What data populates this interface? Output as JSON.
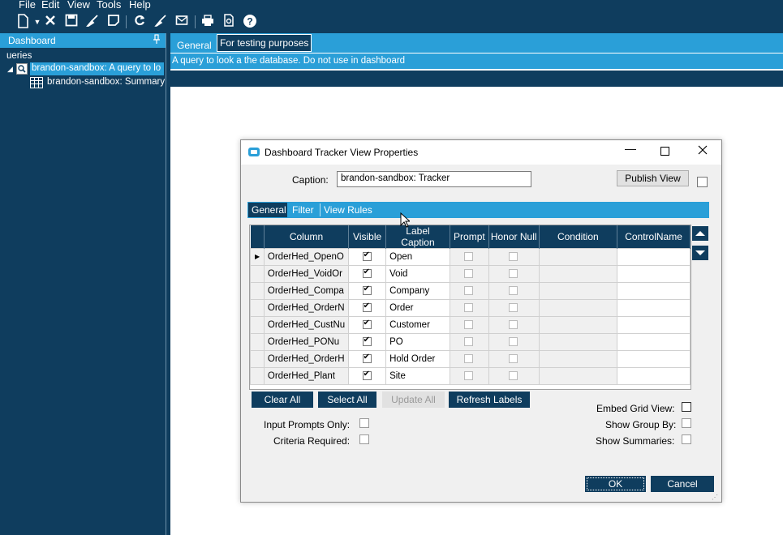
{
  "menu": [
    "File",
    "Edit",
    "View",
    "Tools",
    "Help"
  ],
  "left_panel": {
    "title": "Dashboard",
    "pin": "📌",
    "queries_label": "ueries",
    "items": [
      {
        "label": "brandon-sandbox: A query to lo",
        "selected": true
      },
      {
        "label": "brandon-sandbox: Summary",
        "selected": false
      }
    ]
  },
  "tabs": [
    "General",
    "For testing purposes"
  ],
  "description": "A query to look a the database. Do not use in dashboard",
  "dialog": {
    "title": "Dashboard Tracker View Properties",
    "caption_label": "Caption:",
    "caption_value": "brandon-sandbox: Tracker",
    "publish_button": "Publish View",
    "tabs": [
      "General",
      "Filter",
      "View Rules"
    ],
    "columns": [
      "Column",
      "Visible",
      "Label Caption",
      "Prompt",
      "Honor Null",
      "Condition",
      "ControlName"
    ],
    "rows": [
      {
        "column": "OrderHed_OpenO",
        "label": "Open",
        "visible": true,
        "current": true
      },
      {
        "column": "OrderHed_VoidOr",
        "label": "Void",
        "visible": true
      },
      {
        "column": "OrderHed_Compa",
        "label": "Company",
        "visible": true
      },
      {
        "column": "OrderHed_OrderN",
        "label": "Order",
        "visible": true
      },
      {
        "column": "OrderHed_CustNu",
        "label": "Customer",
        "visible": true
      },
      {
        "column": "OrderHed_PONu",
        "label": "PO",
        "visible": true
      },
      {
        "column": "OrderHed_OrderH",
        "label": "Hold Order",
        "visible": true
      },
      {
        "column": "OrderHed_Plant",
        "label": "Site",
        "visible": true
      }
    ],
    "buttons": {
      "clear_all": "Clear All",
      "select_all": "Select All",
      "update_all": "Update All",
      "refresh_labels": "Refresh Labels",
      "ok": "OK",
      "cancel": "Cancel"
    },
    "options_left": [
      "Input Prompts Only:",
      "Criteria Required:"
    ],
    "options_right": [
      "Embed Grid View:",
      "Show Group By:",
      "Show Summaries:"
    ]
  },
  "colors": {
    "dark": "#0f3d5e",
    "accent": "#2a9fd8"
  }
}
